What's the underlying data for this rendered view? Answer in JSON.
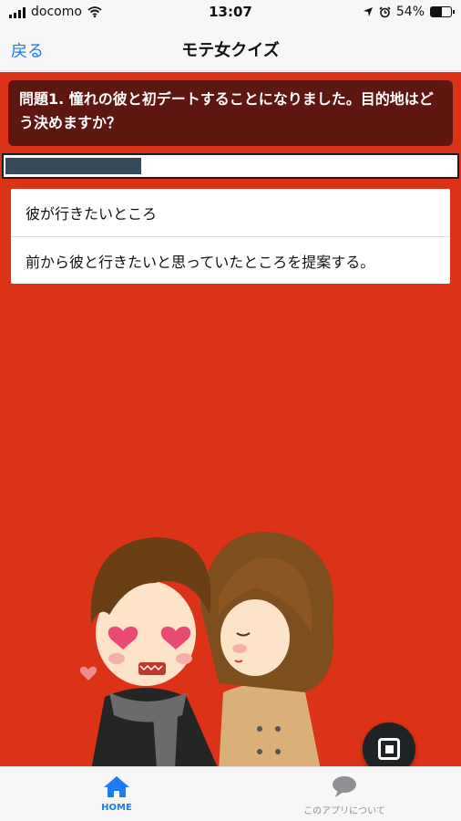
{
  "status_bar": {
    "carrier": "docomo",
    "time": "13:07",
    "battery": "54%",
    "battery_level": 0.54,
    "icons": [
      "signal-icon",
      "wifi-icon",
      "location-arrow-icon",
      "alarm-icon",
      "battery-icon"
    ]
  },
  "nav": {
    "back_label": "戻る",
    "title": "モテ女クイズ"
  },
  "quiz": {
    "question": "問題1. 憧れの彼と初デートすることになりました。目的地はどう決めますか？",
    "progress_fraction": 0.3,
    "choices": [
      {
        "label": "彼が行きたいところ"
      },
      {
        "label": "前から彼と行きたいと思っていたところを提案する。"
      }
    ]
  },
  "illustration": {
    "subject": "couple-illustration"
  },
  "tabs": [
    {
      "label": "HOME",
      "icon": "home-icon",
      "active": true
    },
    {
      "label": "このアプリについて",
      "icon": "speech-bubble-icon",
      "active": false
    }
  ],
  "colors": {
    "background": "#dc3218",
    "question_box": "#5e1710",
    "progress_fill": "#354b5b",
    "accent": "#1e7cf2"
  }
}
